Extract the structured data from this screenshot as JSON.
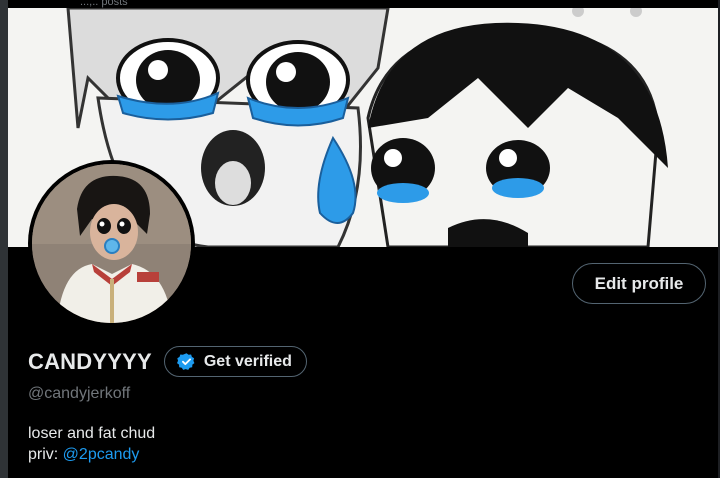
{
  "header": {
    "posts_count_fragment": "...,.. posts"
  },
  "banner": {
    "alt": "profile-banner"
  },
  "profile": {
    "display_name": "CANDYYYY",
    "handle": "@candyjerkoff",
    "bio_line1": "loser and fat chud",
    "bio_line2_prefix": "priv: ",
    "bio_link": "@2pcandy"
  },
  "buttons": {
    "edit_profile": "Edit profile",
    "get_verified": "Get verified"
  },
  "colors": {
    "accent": "#1d9bf0",
    "border": "#536471",
    "muted": "#71767b"
  }
}
